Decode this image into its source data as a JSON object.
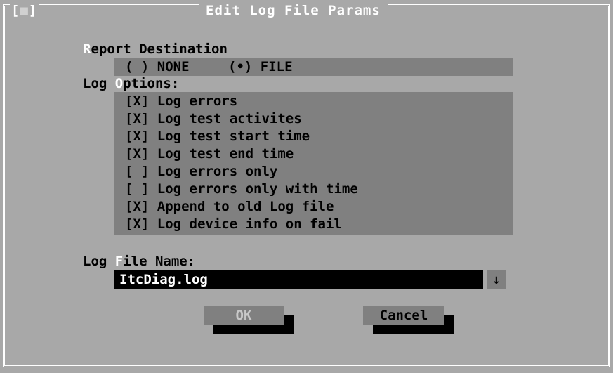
{
  "window": {
    "title": "Edit Log File Params",
    "close_open": "[",
    "close_dot": "■",
    "close_close": "]"
  },
  "report_destination": {
    "label_hot": "R",
    "label_rest": "eport Destination",
    "options": [
      {
        "mark": "( )",
        "label": "NONE",
        "selected": false
      },
      {
        "mark": "(•)",
        "label": "FILE",
        "selected": true
      }
    ]
  },
  "log_options": {
    "label_pre": "Log ",
    "label_hot": "O",
    "label_rest": "ptions:",
    "items": [
      {
        "mark": "[X]",
        "label": "Log errors",
        "checked": true
      },
      {
        "mark": "[X]",
        "label": "Log test activites",
        "checked": true
      },
      {
        "mark": "[X]",
        "label": "Log test start time",
        "checked": true
      },
      {
        "mark": "[X]",
        "label": "Log test end time",
        "checked": true
      },
      {
        "mark": "[ ]",
        "label": "Log errors only",
        "checked": false
      },
      {
        "mark": "[ ]",
        "label": "Log errors only with time",
        "checked": false
      },
      {
        "mark": "[X]",
        "label": "Append to old Log file",
        "checked": true
      },
      {
        "mark": "[X]",
        "label": "Log device info on fail",
        "checked": true
      }
    ]
  },
  "log_file": {
    "label_pre": "Log ",
    "label_hot": "F",
    "label_rest": "ile Name:",
    "value": "ItcDiag.log",
    "dropdown_glyph": "↓"
  },
  "buttons": {
    "ok": "OK",
    "cancel": "Cancel"
  },
  "colors": {
    "background": "#a8a8a8",
    "panel": "#808080",
    "hotkey": "#ffffff",
    "field": "#000000"
  }
}
